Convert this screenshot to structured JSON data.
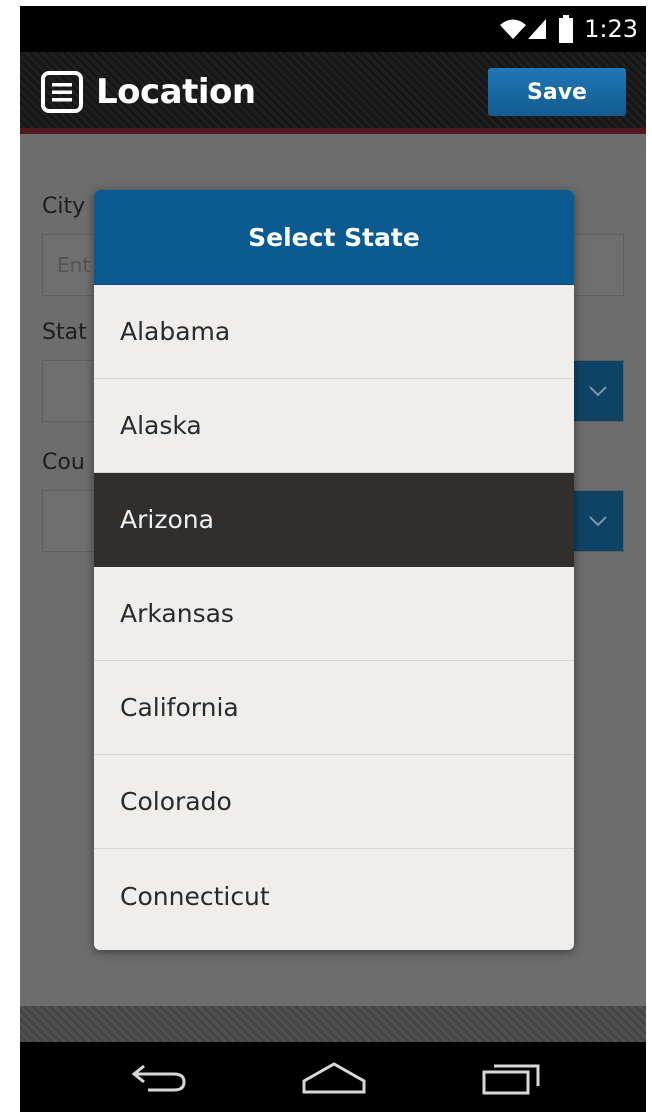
{
  "status_bar": {
    "time": "1:23"
  },
  "action_bar": {
    "title": "Location",
    "save_label": "Save"
  },
  "form": {
    "city_label": "City",
    "city_placeholder": "Ent",
    "state_label": "Stat",
    "country_label": "Cou"
  },
  "modal": {
    "title": "Select State",
    "states": [
      {
        "name": "Alabama",
        "selected": false
      },
      {
        "name": "Alaska",
        "selected": false
      },
      {
        "name": "Arizona",
        "selected": true
      },
      {
        "name": "Arkansas",
        "selected": false
      },
      {
        "name": "California",
        "selected": false
      },
      {
        "name": "Colorado",
        "selected": false
      },
      {
        "name": "Connecticut",
        "selected": false
      }
    ]
  },
  "colors": {
    "header_blue": "#095a91",
    "save_button": "#1f78b7",
    "selected_row": "#302f2d",
    "accent_stripe": "#531821"
  },
  "icons": {
    "menu": "menu-icon",
    "wifi": "wifi-icon",
    "signal": "signal-icon",
    "battery": "battery-icon",
    "dropdown": "chevron-down-icon",
    "back": "back-icon",
    "home": "home-icon",
    "recents": "recent-apps-icon"
  }
}
